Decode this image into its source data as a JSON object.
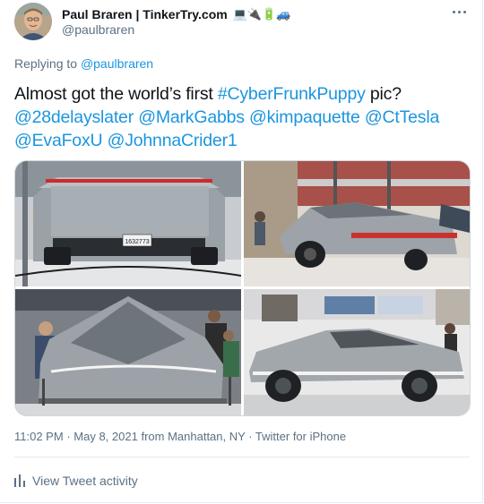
{
  "author": {
    "display_name": "Paul Braren | TinkerTry.com",
    "emojis": "💻🔌🔋🚙",
    "handle": "@paulbraren"
  },
  "reply_prefix": "Replying to",
  "reply_to": "@paulbraren",
  "tweet": {
    "intro": "Almost got the world’s first ",
    "hashtag": "#CyberFrunkPuppy",
    "after_hashtag": " pic?",
    "mentions": [
      "@28delayslater",
      "@MarkGabbs",
      "@kimpaquette",
      "@CtTesla",
      "@EvaFoxU",
      "@JohnnaCrider1"
    ]
  },
  "media": {
    "plate_text": "1632773"
  },
  "meta": {
    "time": "11:02 PM",
    "date": "May 8, 2021",
    "from_prefix": "from",
    "location": "Manhattan, NY",
    "source": "Twitter for iPhone",
    "separator": "·"
  },
  "activity_label": "View Tweet activity",
  "icons": {
    "more": "more-dots-icon",
    "activity": "bar-chart-icon"
  },
  "colors": {
    "link": "#1b95e0",
    "secondary_text": "#5b7083",
    "text": "#0f1419",
    "border": "#e6ecf0"
  }
}
